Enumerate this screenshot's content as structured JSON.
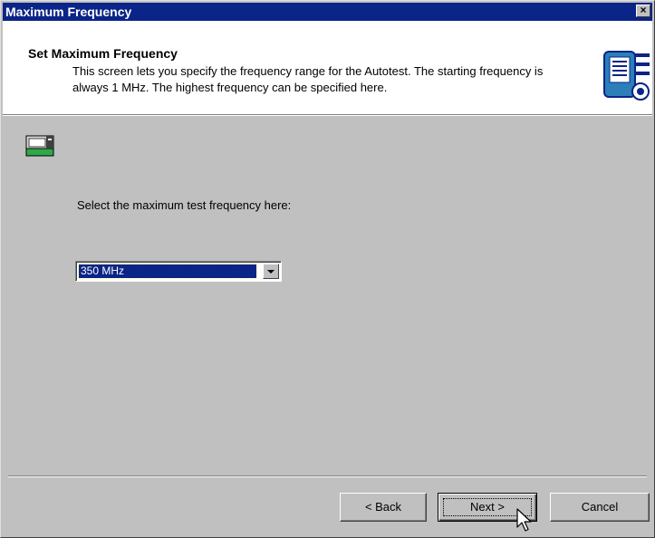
{
  "window": {
    "title": "Maximum Frequency",
    "close_glyph": "×"
  },
  "header": {
    "title": "Set Maximum Frequency",
    "description": "This screen lets you specify the frequency range for the Autotest.  The starting frequency is always 1 MHz.  The highest frequency can be specified here.",
    "icon": "tester-device-icon"
  },
  "body": {
    "icon": "analyzer-icon",
    "prompt": "Select the maximum test frequency here:",
    "frequency_select": {
      "selected": "350 MHz"
    }
  },
  "buttons": {
    "back": "< Back",
    "next": "Next >",
    "cancel": "Cancel"
  },
  "colors": {
    "titlebar": "#0a2487",
    "face": "#c0c0c0",
    "selection": "#0a2487"
  }
}
